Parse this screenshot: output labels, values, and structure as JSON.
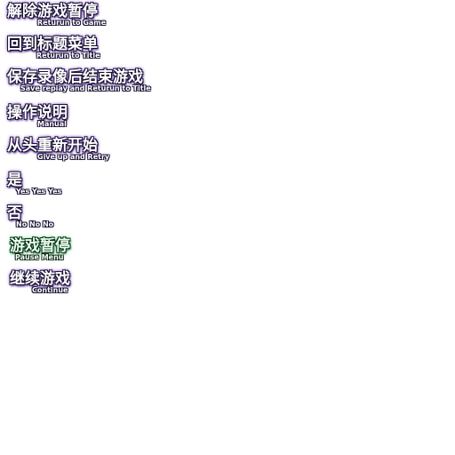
{
  "menu_items": [
    {
      "main": "解除游戏暂停",
      "sub": "Returun to Game"
    },
    {
      "main": "回到标题菜单",
      "sub": "Returun to Title"
    },
    {
      "main": "保存录像后结束游戏",
      "sub": "Save repiay and Returun to Title"
    },
    {
      "main": "操作说明",
      "sub": "Manual"
    },
    {
      "main": "从头重新开始",
      "sub": "Give up and Retry"
    },
    {
      "main": "是",
      "sub": "Yes Yes Yes"
    },
    {
      "main": "否",
      "sub": "No No No"
    },
    {
      "main": "游戏暂停",
      "sub": "Pause Menu"
    },
    {
      "main": "继续游戏",
      "sub": "Continue"
    }
  ]
}
